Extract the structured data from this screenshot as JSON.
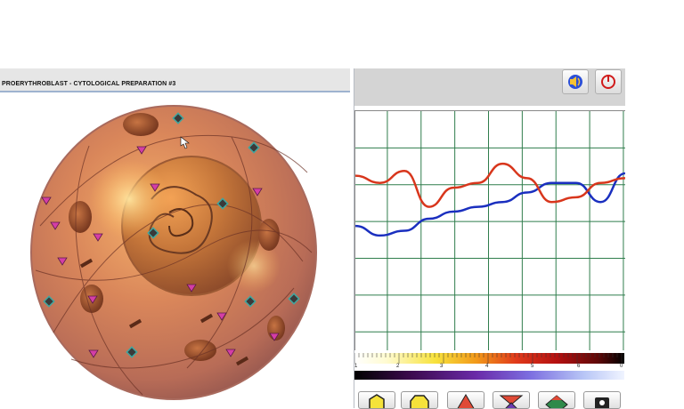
{
  "window": {
    "title": "PROERYTHROBLAST - CYTOLOGICAL PREPARATION #3"
  },
  "toolbar": {
    "sound_icon": "speaker-icon",
    "power_icon": "power-icon"
  },
  "colors": {
    "series_blue": "#1a2fbf",
    "series_red": "#d8361c",
    "grid": "#2f7d4c",
    "marker_pink": "#d43ea6",
    "marker_teal": "#3fa7a0"
  },
  "chart_data": {
    "type": "line",
    "series": [
      {
        "values": [
          0.52,
          0.48,
          0.5,
          0.55,
          0.58,
          0.6,
          0.62,
          0.66,
          0.7,
          0.7,
          0.62,
          0.74
        ]
      },
      {
        "values": [
          0.73,
          0.7,
          0.75,
          0.6,
          0.68,
          0.7,
          0.78,
          0.72,
          0.62,
          0.64,
          0.7,
          0.72
        ]
      }
    ],
    "ylim": [
      0,
      1
    ],
    "grid": true
  },
  "scale": {
    "labels": [
      "1",
      "2",
      "3",
      "4",
      "5",
      "6",
      "0"
    ]
  },
  "bottom_buttons": [
    "yellow-hexagon-icon",
    "yellow-hexagon-icon",
    "red-triangle-icon",
    "red-hourglass-icon",
    "green-diamond-icon",
    "black-square-icon"
  ]
}
